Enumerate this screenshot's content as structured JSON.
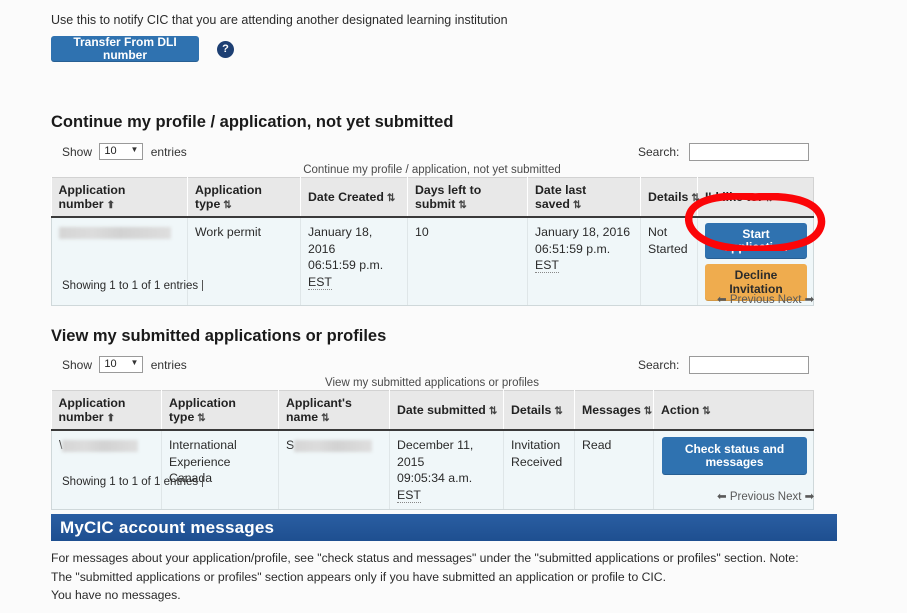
{
  "intro": {
    "text": "Use this to notify CIC that you are attending another designated learning institution",
    "transfer_button": "Transfer From DLI number",
    "help_icon": "?"
  },
  "continue_section": {
    "title": "Continue my profile / application, not yet submitted",
    "length_prefix": "Show",
    "length_value": "10",
    "length_suffix": "entries",
    "search_label": "Search:",
    "search_value": "",
    "caption": "Continue my profile / application, not yet submitted",
    "columns": [
      "Application number",
      "Application type",
      "Date Created",
      "Days left to submit",
      "Date last saved",
      "Details",
      "I'd like to:"
    ],
    "sort_states": [
      "asc",
      "both",
      "both",
      "both",
      "both",
      "both",
      "both"
    ],
    "rows": [
      {
        "application_number": "",
        "application_type": "Work permit",
        "date_created_line1": "January 18, 2016",
        "date_created_line2": "06:51:59 p.m.",
        "date_created_tz": "EST",
        "days_left": "10",
        "date_saved_line1": "January 18, 2016",
        "date_saved_line2": "06:51:59 p.m.",
        "date_saved_tz": "EST",
        "details": "Not Started",
        "action_primary": "Start application",
        "action_secondary": "Decline Invitation"
      }
    ],
    "info": "Showing 1 to 1 of 1 entries",
    "previous": "Previous",
    "next": "Next"
  },
  "submitted_section": {
    "title": "View my submitted applications or profiles",
    "length_prefix": "Show",
    "length_value": "10",
    "length_suffix": "entries",
    "search_label": "Search:",
    "search_value": "",
    "caption": "View my submitted applications or profiles",
    "columns": [
      "Application number",
      "Application type",
      "Applicant's name",
      "Date submitted",
      "Details",
      "Messages",
      "Action"
    ],
    "sort_states": [
      "asc",
      "both",
      "both",
      "both",
      "both",
      "both",
      "both"
    ],
    "rows": [
      {
        "application_number": "\\",
        "application_type_line1": "International",
        "application_type_line2": "Experience Canada",
        "applicant_name": "S",
        "date_submitted_line1": "December 11, 2015",
        "date_submitted_line2": "09:05:34 a.m.",
        "date_submitted_tz": "EST",
        "details_line1": "Invitation",
        "details_line2": "Received",
        "messages": "Read",
        "action": "Check status and messages"
      }
    ],
    "info": "Showing 1 to 1 of 1 entries",
    "previous": "Previous",
    "next": "Next"
  },
  "messages_panel": {
    "header": "MyCIC account messages",
    "body_line1": "For messages about your application/profile, see \"check status and messages\" under the \"submitted applications or profiles\" section. Note: The \"submitted",
    "body_line2": "applications or profiles\" section appears only if you have submitted an application or profile to CIC.",
    "no_messages": "You have no messages."
  },
  "annotation": {
    "shape": "red-ellipse-highlight",
    "color": "#fb0508",
    "target": "Start application"
  },
  "colors": {
    "primary_button": "#2f72b0",
    "warning_button": "#efac4e",
    "panel_header": "#1e4f90",
    "table_header_bg": "#e8e8e8",
    "row_bg": "#f0f7f9",
    "annotation_red": "#fb0508"
  }
}
